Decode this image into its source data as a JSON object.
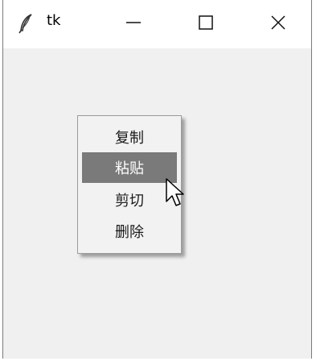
{
  "window": {
    "title": "tk",
    "controls": {
      "minimize": "minimize-icon",
      "maximize": "maximize-icon",
      "close": "close-icon"
    }
  },
  "context_menu": {
    "items": [
      {
        "label": "复制",
        "active": false
      },
      {
        "label": "粘贴",
        "active": true
      },
      {
        "label": "剪切",
        "active": false
      },
      {
        "label": "删除",
        "active": false
      }
    ],
    "highlight_color": "#7a7a7a"
  }
}
